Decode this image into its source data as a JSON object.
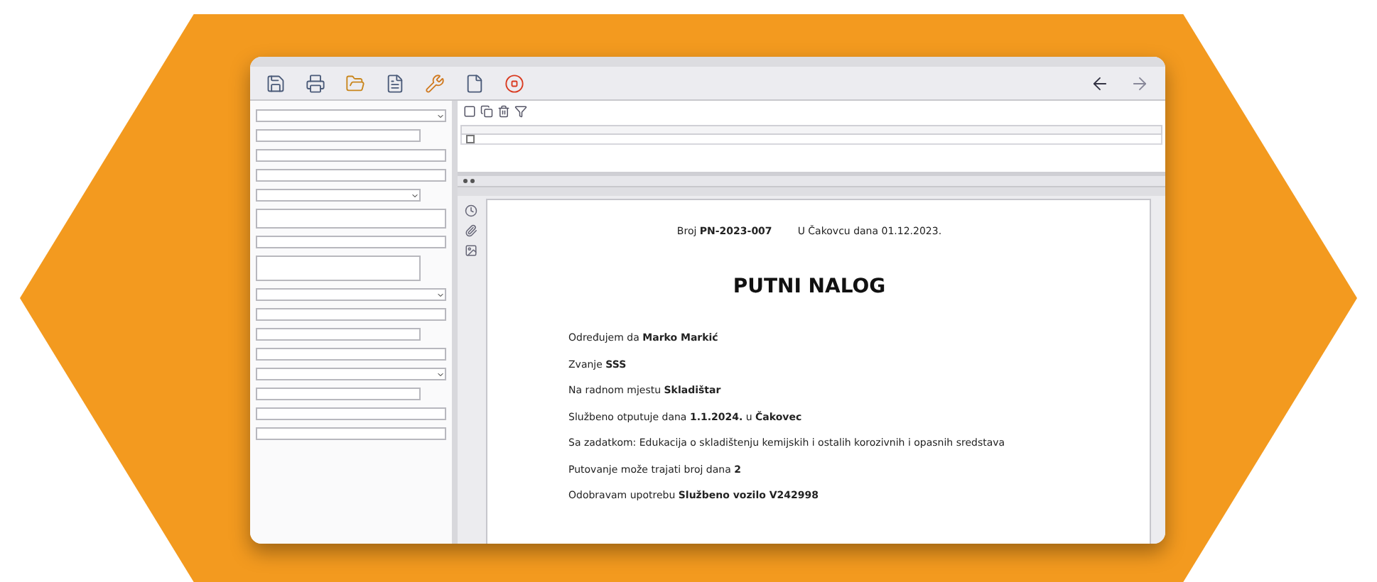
{
  "grid": {
    "rows": [
      {
        "checked": false
      }
    ]
  },
  "document": {
    "number_line": "Broj **PN-2023-007**",
    "place_date": "U Čakovcu dana 01.12.2023.",
    "title": "PUTNI NALOG",
    "lines": [
      "Određujem da **Marko Markić**",
      "Zvanje **SSS**",
      "Na radnom mjestu **Skladištar**",
      "Službeno otputuje dana **1.1.2024.** u **Čakovec**",
      "Sa zadatkom: Edukacija o skladištenju kemijskih i ostalih korozivnih i opasnih sredstava",
      "Putovanje može trajati broj dana **2**",
      "Odobravam upotrebu **Službeno vozilo V242998**"
    ]
  }
}
